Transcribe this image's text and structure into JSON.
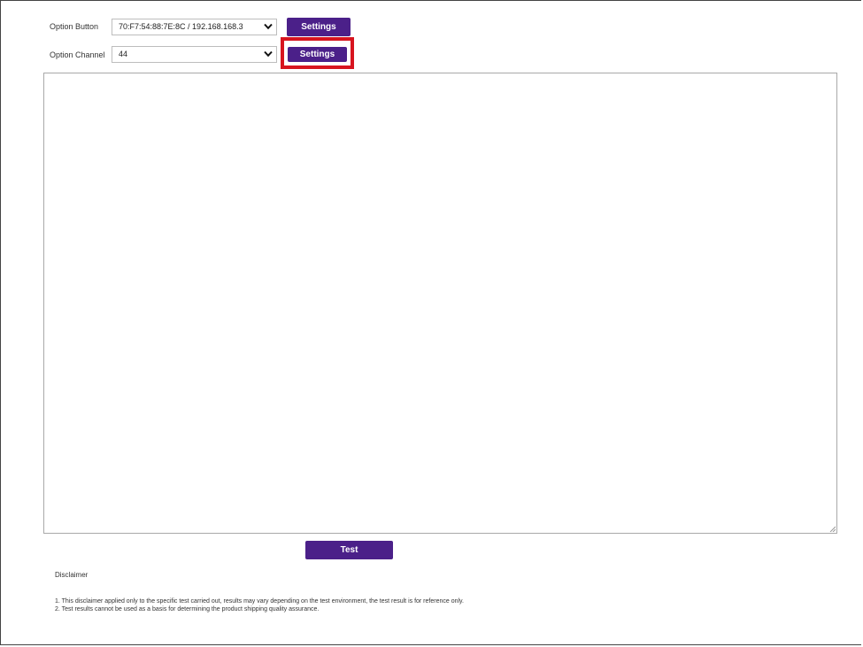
{
  "form": {
    "button_row": {
      "label": "Option Button",
      "selected": "70:F7:54:88:7E:8C / 192.168.168.3",
      "action_label": "Settings"
    },
    "channel_row": {
      "label": "Option Channel",
      "selected": "44",
      "action_label": "Settings"
    }
  },
  "output": {
    "value": ""
  },
  "test_button": {
    "label": "Test"
  },
  "disclaimer": {
    "title": "Disclaimer",
    "lines": [
      "1. This disclaimer applied only to the specific test carried out, results may vary depending on the test environment, the test result is for reference only.",
      "2. Test results cannot be used as a basis for determining the product shipping quality assurance."
    ]
  },
  "icons": {
    "dropdown": "chevron-down-icon",
    "resize": "resize-handle-icon"
  },
  "colors": {
    "button_bg": "#4b2089",
    "button_text": "#ffffff",
    "highlight": "#d7141f"
  }
}
